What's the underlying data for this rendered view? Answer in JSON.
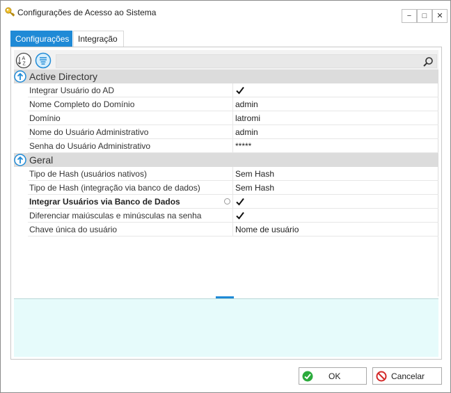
{
  "window": {
    "title": "Configurações de Acesso ao Sistema",
    "minimize_label": "−",
    "maximize_label": "□",
    "close_label": "✕"
  },
  "tabs": [
    {
      "label": "Configurações",
      "active": true
    },
    {
      "label": "Integração",
      "active": false
    }
  ],
  "toolbar": {
    "sort_icon": "sort-alphabetical-icon",
    "categorized_icon": "categorized-icon",
    "search_placeholder": "",
    "search_icon": "search-icon"
  },
  "categories": [
    {
      "label": "Active Directory",
      "properties": [
        {
          "name": "Integrar Usuário do AD",
          "value": "",
          "checked": true
        },
        {
          "name": "Nome Completo do Domínio",
          "value": "admin"
        },
        {
          "name": "Domínio",
          "value": "latromi"
        },
        {
          "name": "Nome do Usuário Administrativo",
          "value": "admin"
        },
        {
          "name": "Senha do Usuário Administrativo",
          "value": "*****"
        }
      ]
    },
    {
      "label": "Geral",
      "properties": [
        {
          "name": "Tipo de Hash (usuários nativos)",
          "value": "Sem Hash"
        },
        {
          "name": "Tipo de Hash (integração via banco de dados)",
          "value": "Sem Hash"
        },
        {
          "name": "Integrar Usuários via Banco de Dados",
          "value": "",
          "checked": true,
          "bold": true,
          "modified": true
        },
        {
          "name": "Diferenciar maiúsculas e minúsculas na senha",
          "value": "",
          "checked": true
        },
        {
          "name": "Chave única do usuário",
          "value": "Nome de usuário"
        }
      ]
    }
  ],
  "buttons": {
    "ok": "OK",
    "cancel": "Cancelar"
  },
  "colors": {
    "accent": "#1f8ad6",
    "category_bg": "#dcdcdc",
    "description_bg": "#e6fbfb",
    "ok_green": "#2bab3c",
    "cancel_red": "#d42a2a"
  }
}
